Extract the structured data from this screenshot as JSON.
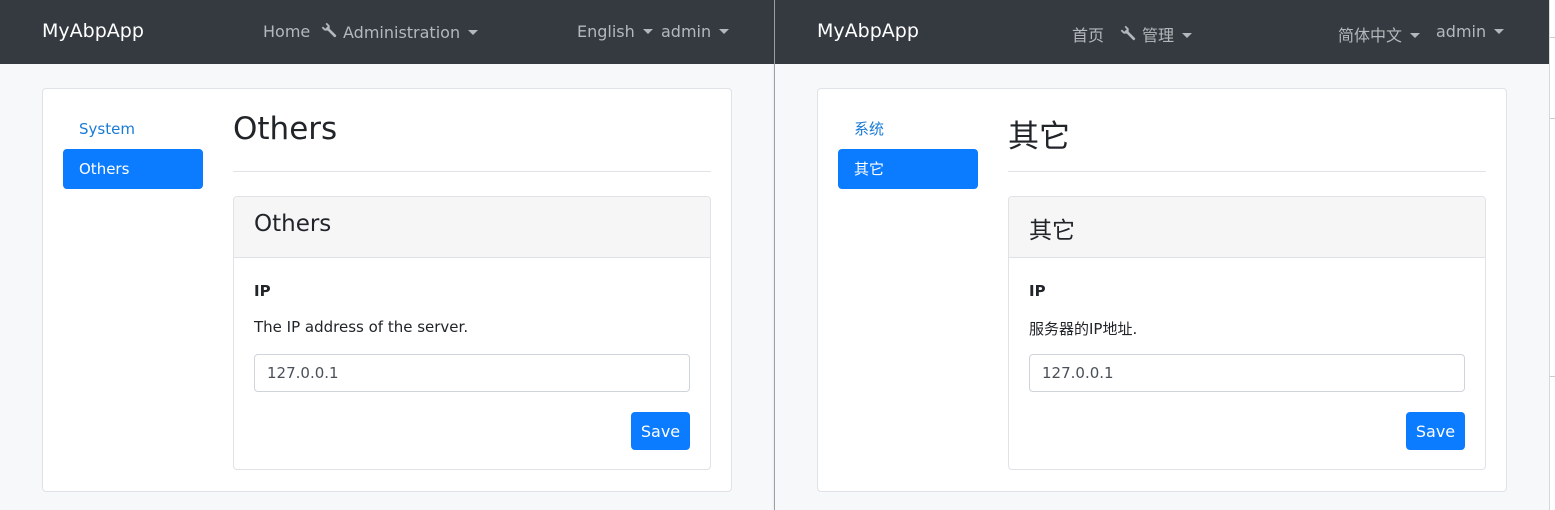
{
  "colors": {
    "navbar": "#343a40",
    "nav_text": "#b4b8bc",
    "brand_text": "#ffffff",
    "primary": "#0b7bff",
    "link": "#1a7bd6",
    "page_bg": "#f7f8fa",
    "panel_header_bg": "#f6f6f7"
  },
  "panes": {
    "english": {
      "brand": "MyAbpApp",
      "nav": {
        "home": "Home",
        "administration": "Administration",
        "language": "English",
        "user": "admin"
      },
      "sidebar": {
        "items": [
          "System",
          "Others"
        ],
        "active_index": 1
      },
      "page_title": "Others",
      "panel": {
        "title": "Others",
        "field_label": "IP",
        "field_description": "The IP address of the server.",
        "field_value": "127.0.0.1",
        "save_label": "Save"
      }
    },
    "chinese": {
      "brand": "MyAbpApp",
      "nav": {
        "home": "首页",
        "administration": "管理",
        "language": "简体中文",
        "user": "admin"
      },
      "sidebar": {
        "items": [
          "系统",
          "其它"
        ],
        "active_index": 1
      },
      "page_title": "其它",
      "panel": {
        "title": "其它",
        "field_label": "IP",
        "field_description": "服务器的IP地址.",
        "field_value": "127.0.0.1",
        "save_label": "Save"
      }
    }
  },
  "icons": {
    "administration": "wrench-icon",
    "dropdown": "caret-down-icon"
  }
}
